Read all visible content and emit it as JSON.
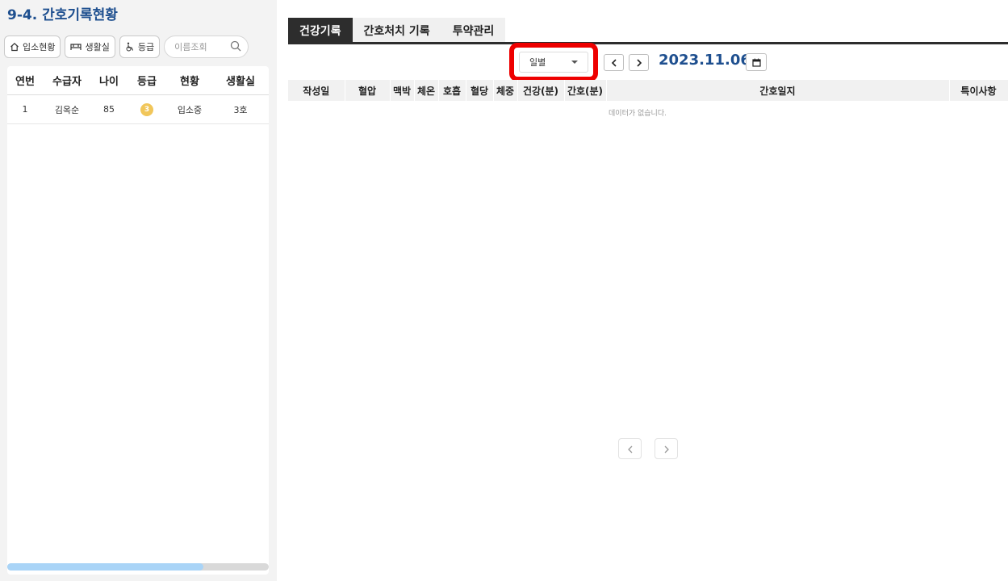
{
  "left": {
    "title": "9-4. 간호기록현황",
    "filters": {
      "admission": "입소현황",
      "room": "생활실",
      "grade": "등급"
    },
    "search": {
      "placeholder": "이름조회"
    },
    "columns": [
      "연번",
      "수급자",
      "나이",
      "등급",
      "현황",
      "생활실"
    ],
    "rows": [
      {
        "no": "1",
        "name": "김옥순",
        "age": "85",
        "grade": "3",
        "status": "입소중",
        "room": "3호"
      }
    ],
    "scroll_fraction": 0.75
  },
  "right": {
    "tabs": [
      "건강기록",
      "간호처치 기록",
      "투약관리"
    ],
    "active_tab": 0,
    "period": "일별",
    "date": "2023.11.06",
    "columns": [
      "작성일",
      "혈압",
      "맥박",
      "체온",
      "호흡",
      "혈당",
      "체중",
      "건강(분)",
      "간호(분)",
      "간호일지",
      "특이사항"
    ],
    "empty_message": "데이터가 없습니다."
  },
  "colors": {
    "title": "#1e4f8f",
    "active_tab": "#2d2d2d",
    "highlight": "#ee0000",
    "grade_badge": "#f1c65a",
    "scroll_thumb": "#a9d4f7"
  }
}
